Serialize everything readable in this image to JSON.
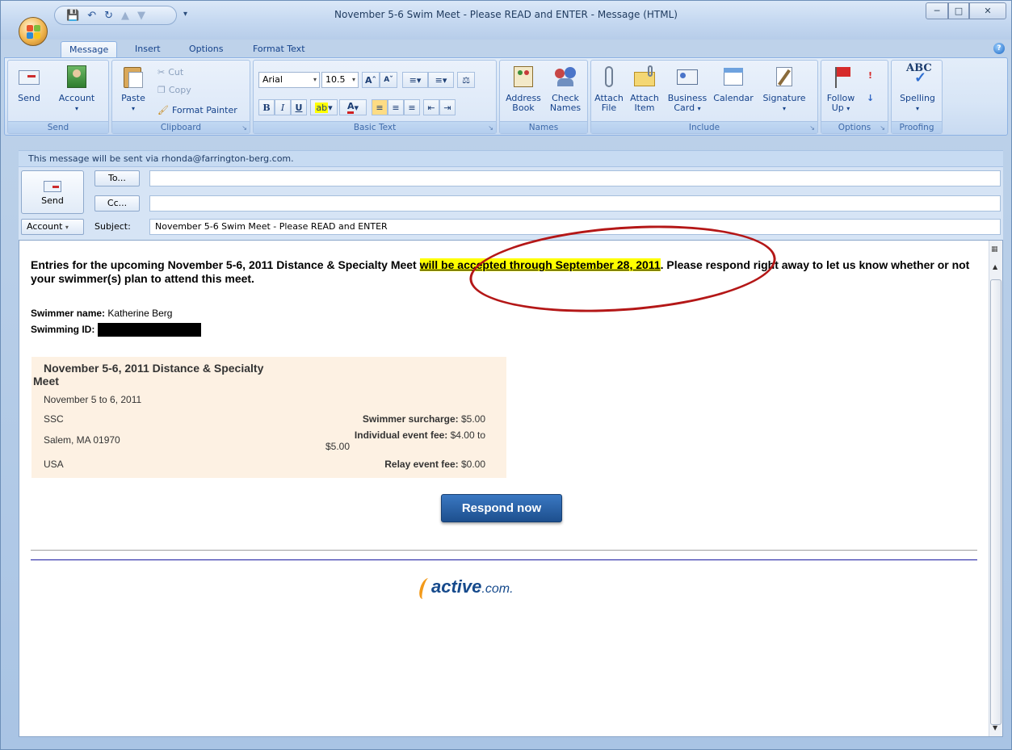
{
  "window": {
    "title": "November 5-6 Swim Meet - Please READ and ENTER - Message (HTML)"
  },
  "ribbon": {
    "tabs": [
      "Message",
      "Insert",
      "Options",
      "Format Text"
    ],
    "groups": {
      "send": {
        "label": "Send",
        "send_btn": "Send",
        "account_btn": "Account"
      },
      "clipboard": {
        "label": "Clipboard",
        "paste": "Paste",
        "cut": "Cut",
        "copy": "Copy",
        "format_painter": "Format Painter"
      },
      "basic_text": {
        "label": "Basic Text",
        "font": "Arial",
        "size": "10.5"
      },
      "names": {
        "label": "Names",
        "address_book": "Address Book",
        "check_names": "Check Names"
      },
      "include": {
        "label": "Include",
        "attach_file": "Attach File",
        "attach_item": "Attach Item",
        "business_card": "Business Card",
        "calendar": "Calendar",
        "signature": "Signature"
      },
      "options": {
        "label": "Options",
        "follow_up": "Follow Up"
      },
      "proofing": {
        "label": "Proofing",
        "spelling": "Spelling"
      }
    }
  },
  "infobar": "This message will be sent via rhonda@farrington-berg.com.",
  "header": {
    "send": "Send",
    "to_btn": "To...",
    "cc_btn": "Cc...",
    "account_btn": "Account",
    "subject_label": "Subject:",
    "to_value": "",
    "cc_value": "",
    "subject_value": "November 5-6 Swim Meet - Please READ and ENTER"
  },
  "message": {
    "intro_before": "Entries for the upcoming November 5-6, 2011 Distance & Specialty Meet ",
    "intro_highlight": "will be accepted through September 28, 2011",
    "intro_after": ". Please respond right away to let us know whether or not your swimmer(s) plan to attend this meet.",
    "swimmer_name_label": "Swimmer name:",
    "swimmer_name": "Katherine Berg",
    "swimming_id_label": "Swimming ID:",
    "meet": {
      "title_line1": "November 5-6, 2011 Distance & Specialty",
      "title_line2": "Meet",
      "dates": "November 5 to 6, 2011",
      "venue": "SSC",
      "city": "Salem, MA 01970",
      "country": "USA",
      "swimmer_surcharge_label": "Swimmer surcharge:",
      "swimmer_surcharge": "$5.00",
      "individual_fee_label": "Individual event fee:",
      "individual_fee_a": "$4.00 to",
      "individual_fee_b": "$5.00",
      "relay_fee_label": "Relay event fee:",
      "relay_fee": "$0.00"
    },
    "respond_button": "Respond now",
    "logo_word": "active",
    "logo_suffix": ".com."
  }
}
